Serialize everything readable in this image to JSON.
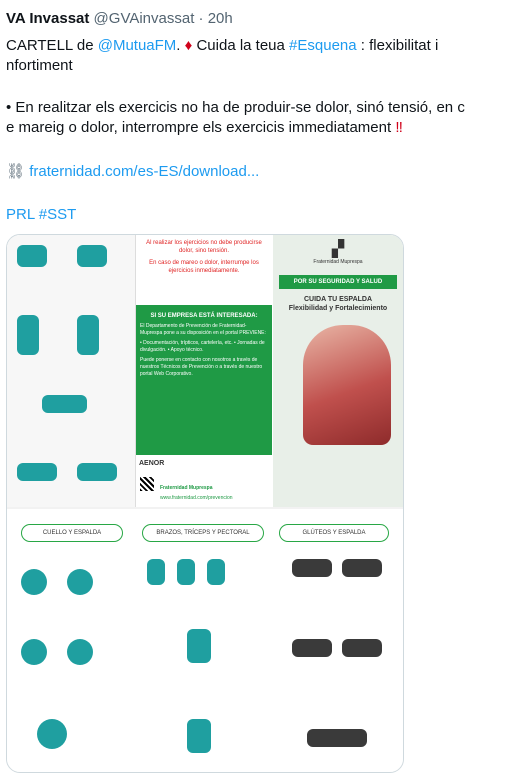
{
  "tweet": {
    "display_name": "VA Invassat",
    "handle": "@GVAinvassat",
    "separator": "·",
    "time": "20h",
    "line1_prefix": "CARTELL de ",
    "mention": "@MutuaFM",
    "diamond": "♦",
    "line1_mid": " Cuida la teua ",
    "hashtag_espalda": "#Esquena",
    "line1_suffix": " : flexibilitat i",
    "line2": "nfortiment",
    "line3": "En realitzar els exercicis no ha de produir-se dolor, sinó tensió, en c",
    "line4_text": "e mareig o dolor, interrompre els exercicis immediatament ",
    "line4_mark": "‼",
    "link": "fraternidad.com/es-ES/download...",
    "hashtags": "PRL  #SST"
  },
  "poster": {
    "top_warning": "Al realizar los ejercicios no debe producirse dolor, sino tensión.",
    "top_warning2": "En caso de mareo o dolor, interrumpe los ejercicios inmediatamente.",
    "green_title": "SI SU EMPRESA ESTÁ INTERESADA:",
    "green_text": "El Departamento de Prevención de Fraternidad-Muprespa pone a su disposición en el portal PREVIENE:",
    "green_bullets": "• Documentación, trípticos, cartelería, etc. • Jornadas de divulgación. • Apoyo técnico.",
    "green_text2": "Puede ponerse en contacto con nosotros a través de nuestros Técnicos de Prevención o a través de nuestro portal Web Corporativo.",
    "aenor": "AENOR",
    "website": "www.fraternidad.com/prevencion",
    "brand": "Fraternidad Muprespa",
    "banner": "POR SU SEGURIDAD Y SALUD",
    "title_line1": "CUIDA TU ESPALDA",
    "title_line2": "Flexibilidad y Fortalecimiento",
    "section1": "CUELLO Y ESPALDA",
    "section2": "BRAZOS, TRÍCEPS Y PECTORAL",
    "section3": "GLÚTEOS Y ESPALDA"
  }
}
